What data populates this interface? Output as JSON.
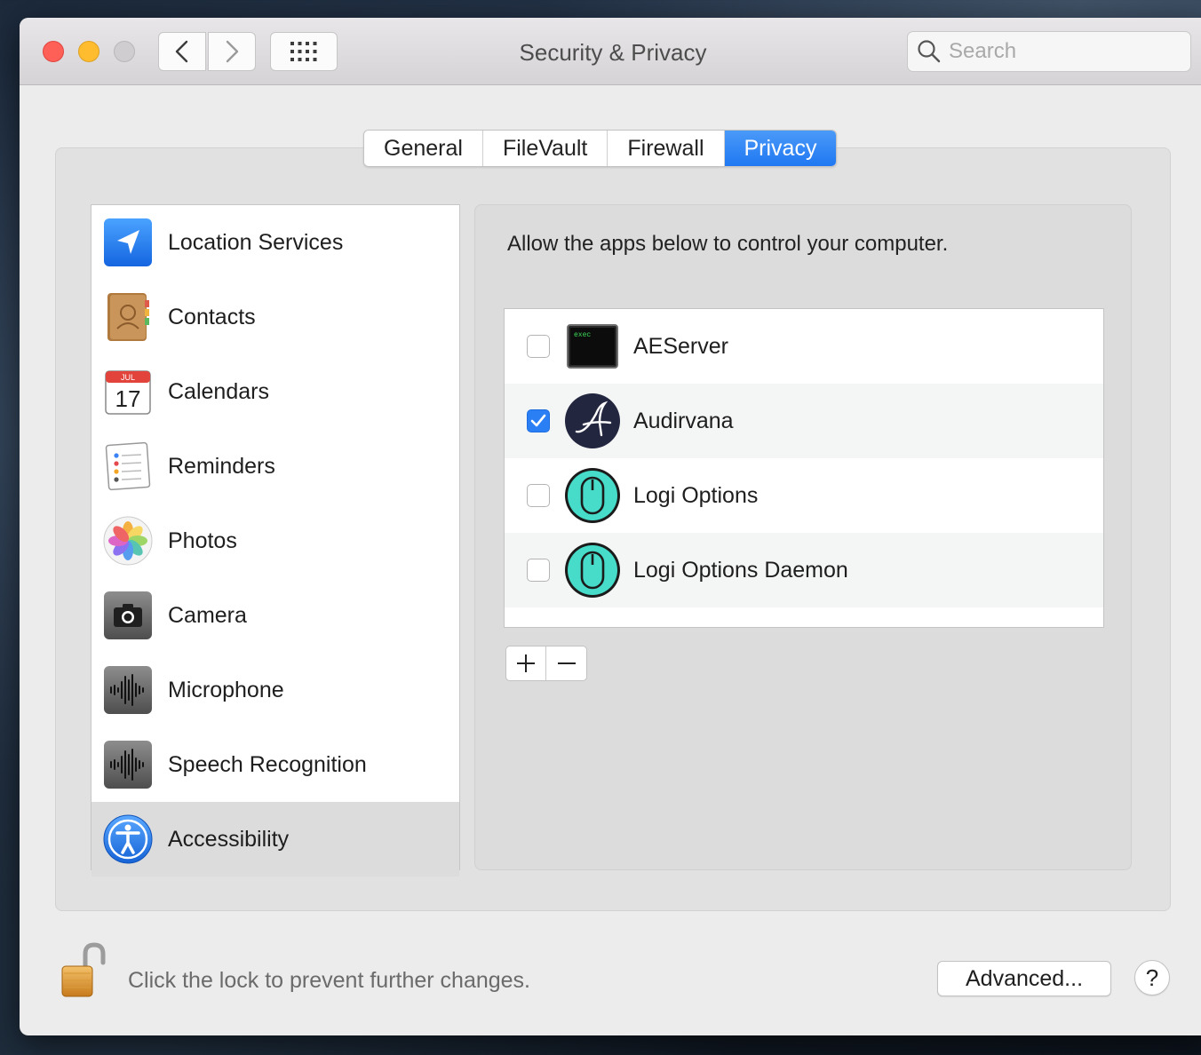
{
  "window": {
    "title": "Security & Privacy"
  },
  "toolbar": {
    "search_placeholder": "Search"
  },
  "tabs": [
    {
      "label": "General"
    },
    {
      "label": "FileVault"
    },
    {
      "label": "Firewall"
    },
    {
      "label": "Privacy",
      "active": true
    }
  ],
  "sidebar": {
    "items": [
      {
        "label": "Location Services",
        "icon": "location-arrow-icon"
      },
      {
        "label": "Contacts",
        "icon": "contacts-book-icon"
      },
      {
        "label": "Calendars",
        "icon": "calendar-icon",
        "icon_month": "JUL",
        "icon_day": "17"
      },
      {
        "label": "Reminders",
        "icon": "reminders-list-icon"
      },
      {
        "label": "Photos",
        "icon": "photos-flower-icon"
      },
      {
        "label": "Camera",
        "icon": "camera-icon"
      },
      {
        "label": "Microphone",
        "icon": "waveform-icon"
      },
      {
        "label": "Speech Recognition",
        "icon": "waveform-icon"
      },
      {
        "label": "Accessibility",
        "icon": "accessibility-icon",
        "selected": true
      }
    ]
  },
  "content": {
    "description": "Allow the apps below to control your computer.",
    "apps": [
      {
        "name": "AEServer",
        "checked": false,
        "icon": "exec-terminal-icon",
        "icon_text": "exec"
      },
      {
        "name": "Audirvana",
        "checked": true,
        "icon": "audirvana-icon"
      },
      {
        "name": "Logi Options",
        "checked": false,
        "icon": "logi-mouse-icon"
      },
      {
        "name": "Logi Options Daemon",
        "checked": false,
        "icon": "logi-mouse-icon"
      }
    ]
  },
  "footer": {
    "lock_text": "Click the lock to prevent further changes.",
    "advanced_label": "Advanced...",
    "help_label": "?"
  },
  "colors": {
    "accent": "#2b7ff5",
    "close": "#fe5f57",
    "minimize": "#febc2e"
  }
}
